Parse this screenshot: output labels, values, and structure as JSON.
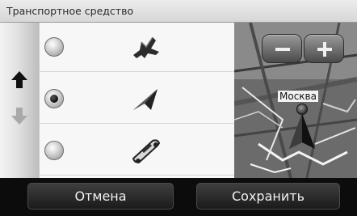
{
  "header": {
    "title": "Транспортное средство"
  },
  "rail": {
    "up_icon": "arrow-up-icon",
    "down_icon": "arrow-down-icon"
  },
  "list": {
    "items": [
      {
        "icon": "airplane-icon",
        "selected": false
      },
      {
        "icon": "arrow-chevron-icon",
        "selected": true
      },
      {
        "icon": "car-icon",
        "selected": false
      }
    ]
  },
  "map": {
    "zoom_out_icon": "minus-icon",
    "zoom_in_icon": "plus-icon",
    "city_label": "Москва"
  },
  "footer": {
    "cancel_label": "Отмена",
    "save_label": "Сохранить"
  }
}
